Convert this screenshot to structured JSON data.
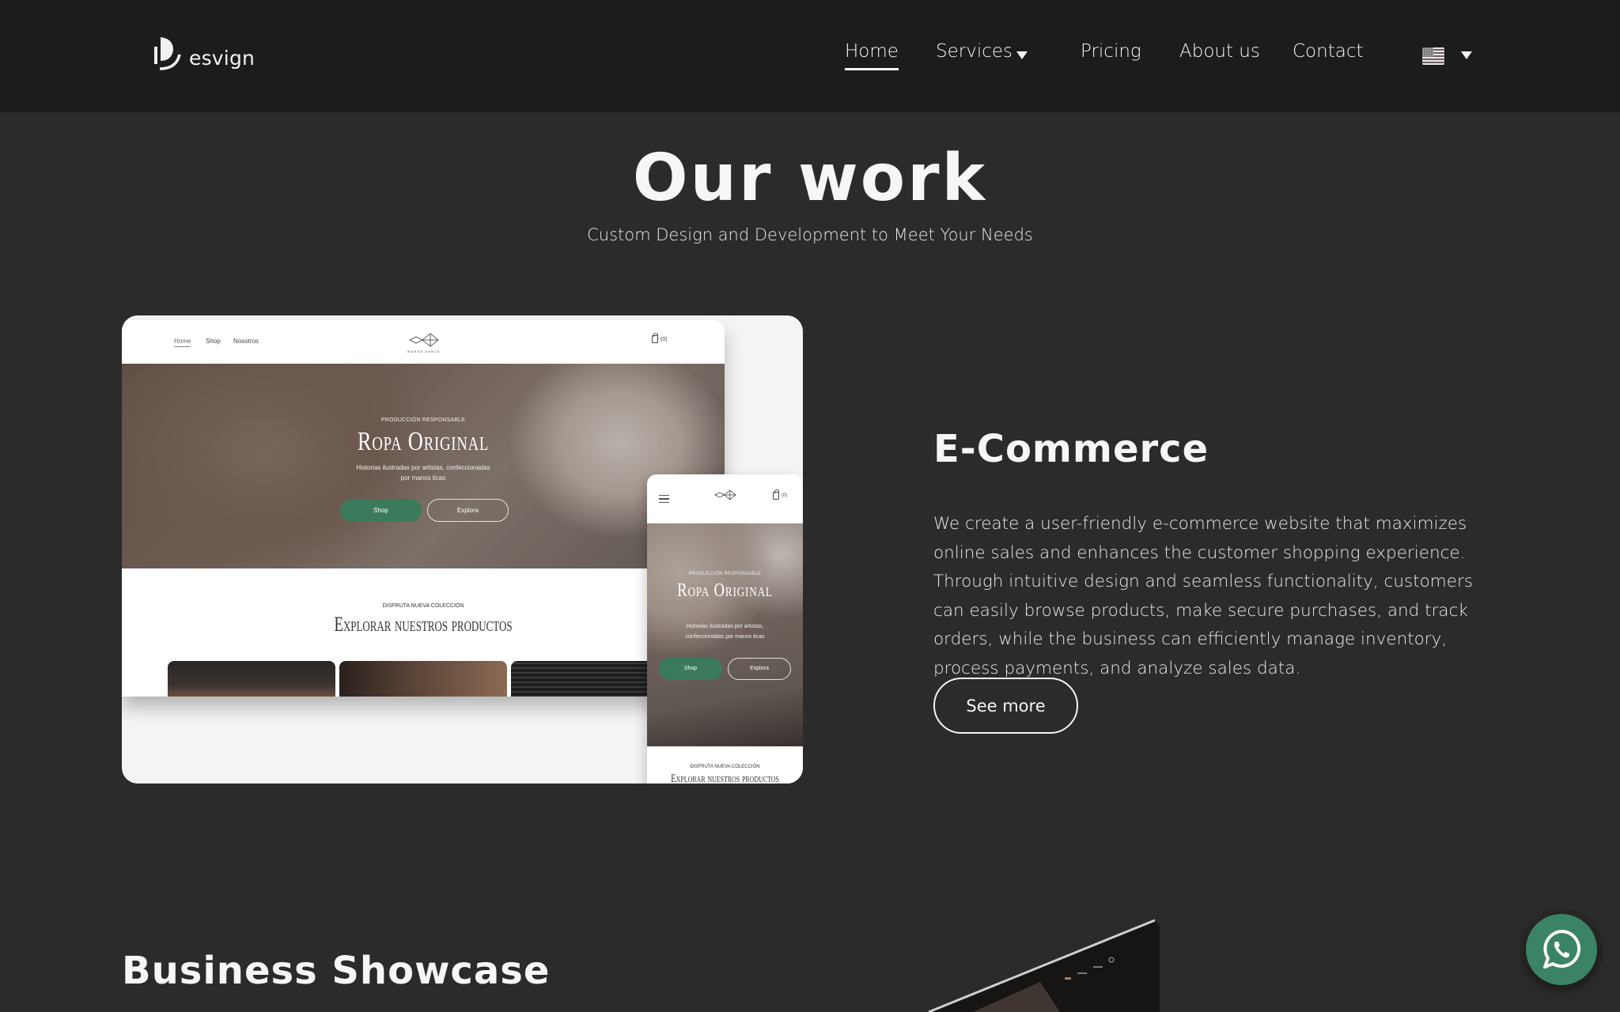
{
  "header": {
    "logo_text": "esvign",
    "nav": [
      {
        "label": "Home",
        "active": true
      },
      {
        "label": "Services",
        "has_dropdown": true
      },
      {
        "label": "Pricing"
      },
      {
        "label": "About us"
      },
      {
        "label": "Contact"
      }
    ],
    "language": {
      "flag": "us-flag-icon",
      "dropdown": true
    }
  },
  "page": {
    "title": "Our work",
    "subtitle": "Custom Design and Development to Meet Your Needs"
  },
  "project_ecommerce": {
    "title": "E-Commerce",
    "description": "We create a user-friendly e-commerce website that maximizes online sales and enhances the customer shopping experience. Through intuitive design and seamless functionality, customers can easily browse products, make secure purchases, and track orders, while the business can efficiently manage inventory, process payments, and analyze sales data.",
    "button_label": "See more",
    "mockup": {
      "nav": [
        "Home",
        "Shop",
        "Nosotros"
      ],
      "brand": "MAREA SANTA",
      "cart": "(0)",
      "hero_eyebrow": "PRODUCCIÓN RESPONSABLE",
      "hero_title": "Ropa Original",
      "hero_text": "Historias ilustradas por artistas, confeccionadas por manos ticas",
      "hero_text_line1": "Historias ilustradas por artistas, confeccionadas",
      "hero_text_line2": "por manos ticas",
      "phone_text_line1": "Historias ilustradas por artistas,",
      "phone_text_line2": "confeccionadas por manos ticas",
      "btn_primary": "Shop",
      "btn_secondary": "Explora",
      "section_eyebrow": "DISFRUTA NUEVA COLECCIÓN",
      "section_title": "Explorar nuestros productos"
    }
  },
  "project_business": {
    "title": "Business Showcase"
  },
  "colors": {
    "header_bg": "#1c1c1b",
    "page_bg": "#2b2b2b",
    "mock_green": "#3b7a5c",
    "whatsapp": "#3a8465"
  },
  "floating": {
    "whatsapp_icon": "whatsapp-icon"
  }
}
